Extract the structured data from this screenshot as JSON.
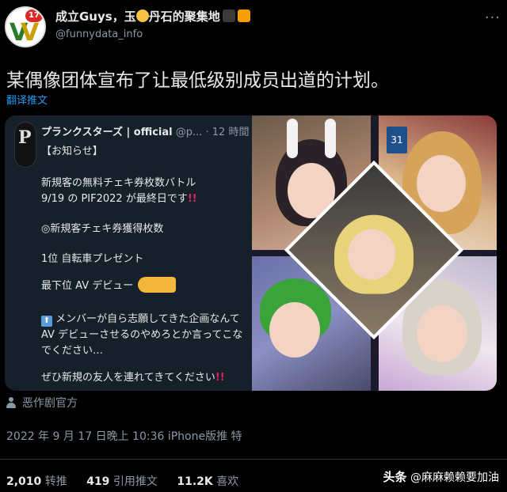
{
  "author": {
    "name_part1": "成立Guys，玉",
    "name_part2": "丹石的聚集地",
    "handle": "@funnydata_info",
    "avatar_badge": "17",
    "more_label": "···"
  },
  "tweet": {
    "text": "某偶像团体宣布了让最低级别成员出道的计划。",
    "translate_label": "翻译推文"
  },
  "quoted": {
    "name": "プランクスターズ | official",
    "meta": "@p... · 12 時間",
    "lines": [
      "【お知らせ】",
      "新規客の無料チェキ券枚数バトル",
      "9/19 の PIF2022 が最終日です",
      "◎新規客チェキ券獲得枚数",
      "1位 自転車プレゼント",
      "最下位 AV デビュー",
      "メンバーが自ら志願してきた企画なんて",
      "AV デビューさせるのやめろとか言ってこな",
      "でください…",
      "ぜひ新規の友人を連れてきてください"
    ],
    "exclaim": "!!",
    "avatar_letter": "P"
  },
  "retweeter": "恶作剧官方",
  "timestamp": "2022 年 9 月 17 日晚上 10:36 iPhone版推 特",
  "stats": {
    "retweets": "2,010",
    "retweets_label": "转推",
    "quotes": "419",
    "quotes_label": "引用推文",
    "likes": "11.2K",
    "likes_label": "喜欢"
  },
  "watermark": {
    "brand": "头条",
    "account": "@麻麻赖赖要加油"
  }
}
